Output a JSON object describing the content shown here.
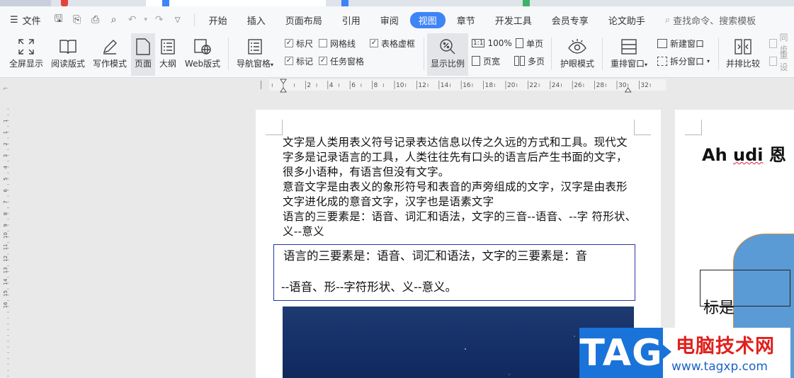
{
  "menubar": {
    "file_label": "文件",
    "tabs": [
      {
        "label": "开始"
      },
      {
        "label": "插入"
      },
      {
        "label": "页面布局"
      },
      {
        "label": "引用"
      },
      {
        "label": "审阅"
      },
      {
        "label": "视图",
        "active": true
      },
      {
        "label": "章节"
      },
      {
        "label": "开发工具"
      },
      {
        "label": "会员专享"
      },
      {
        "label": "论文助手"
      }
    ],
    "search_label": "查找命令、搜索模板"
  },
  "ribbon": {
    "fullscreen": "全屏显示",
    "read_mode": "阅读版式",
    "write_mode": "写作模式",
    "page_view": "页面",
    "outline": "大纲",
    "web_layout": "Web版式",
    "nav_pane": "导航窗格",
    "ruler": "标尺",
    "gridlines": "网格线",
    "table_gridlines": "表格虚框",
    "marks": "标记",
    "task_pane": "任务窗格",
    "zoom": "显示比例",
    "zoom_100": "100%",
    "page_width": "页宽",
    "single_page": "单页",
    "multi_page": "多页",
    "eye_protection": "护眼模式",
    "arrange_window": "重排窗口",
    "new_window": "新建窗口",
    "split_window": "拆分窗口",
    "side_by_side": "并排比较",
    "sync_scroll": "同步",
    "reset_position": "重设",
    "checkbox_state": {
      "ruler": true,
      "gridlines": false,
      "table_gridlines": true,
      "marks": true,
      "task_pane": true
    }
  },
  "ruler": {
    "ticks": [
      "2",
      "4",
      "6",
      "8",
      "10",
      "12",
      "14",
      "16",
      "18",
      "20",
      "22",
      "24",
      "26",
      "28",
      "30",
      "32"
    ],
    "vticks": [
      "1",
      "1",
      "2",
      "3",
      "4",
      "5",
      "6",
      "7",
      "8",
      "9",
      "10",
      "11",
      "12",
      "13",
      "14",
      "15",
      "16"
    ]
  },
  "document": {
    "paragraphs": [
      "文字是人类用表义符号记录表达信息以传之久远的方式和工具。现代文字多是记录语言的工具，人类往往先有口头的语言后产生书面的文字，很多小语种，有语言但没有文字。",
      "意音文字是由表义的象形符号和表音的声旁组成的文字，汉字是由表形文字进化成的意音文字，汉字也是语素文字",
      "语言的三要素是：语音、词汇和语法，文字的三音--语音、--字 符形状、义--意义"
    ],
    "textbox_line1": "语言的三要素是：语音、词汇和语法，文字的三要素是：音",
    "textbox_line2": "--语音、形--字符形状、义--意义。",
    "page2_title_a": "Ah ",
    "page2_title_b": "udi",
    "page2_title_c": " 恩",
    "page2_label": "标是"
  },
  "watermark": {
    "tag": "TAG",
    "site_name": "电脑技术网",
    "url": "www.tagxp.com"
  },
  "colors": {
    "accent": "#3f84f6",
    "textbox_border": "#2336a8",
    "shape_fill": "#5b9bd5",
    "watermark_blue": "#1a73d9",
    "watermark_red": "#e0201c"
  }
}
